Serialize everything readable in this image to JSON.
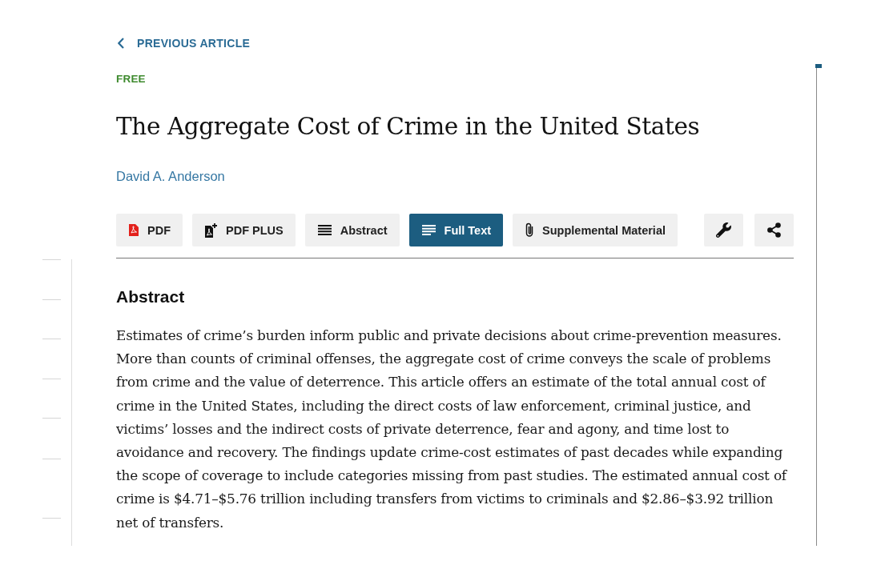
{
  "previous_link": {
    "label": "PREVIOUS ARTICLE"
  },
  "access": "FREE",
  "title": "The Aggregate Cost of Crime in the United States",
  "authors": [
    "David A. Anderson"
  ],
  "toolbar": {
    "buttons": [
      {
        "kind": "pdf",
        "label": "PDF",
        "selected": false
      },
      {
        "kind": "pdf_plus",
        "label": "PDF PLUS",
        "selected": false
      },
      {
        "kind": "abstract",
        "label": "Abstract",
        "selected": false
      },
      {
        "kind": "full_text",
        "label": "Full Text",
        "selected": true
      },
      {
        "kind": "supplement",
        "label": "Supplemental Material",
        "selected": false
      }
    ],
    "tools": [
      {
        "kind": "tools"
      },
      {
        "kind": "share"
      }
    ]
  },
  "abstract": {
    "heading": "Abstract",
    "text": "Estimates of crime’s burden inform public and private decisions about crime-prevention measures. More than counts of criminal offenses, the aggregate cost of crime conveys the scale of problems from crime and the value of deterrence. This article offers an estimate of the total annual cost of crime in the United States, including the direct costs of law enforcement, criminal justice, and victims’ losses and the indirect costs of private deterrence, fear and agony, and time lost to avoidance and recovery. The findings update crime-cost estimates of past decades while expanding the scope of coverage to include categories missing from past studies. The estimated annual cost of crime is $4.71–$5.76 trillion including transfers from victims to criminals and $2.86–$3.92 trillion net of transfers."
  }
}
